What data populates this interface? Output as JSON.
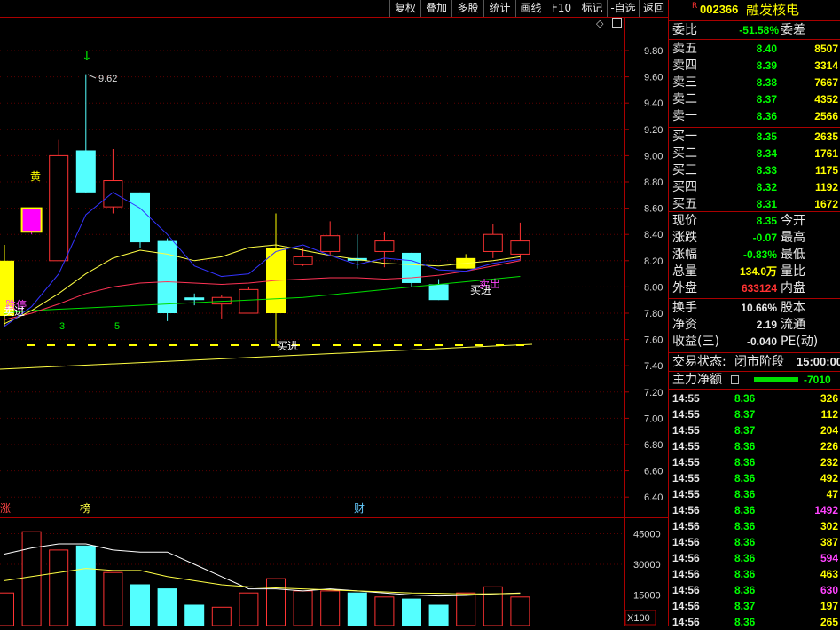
{
  "toolbar": {
    "buttons": [
      "复权",
      "叠加",
      "多股",
      "统计",
      "画线",
      "F10",
      "标记",
      "-自选",
      "返回"
    ]
  },
  "chart": {
    "price_axis": [
      "9.80",
      "9.60",
      "9.40",
      "9.20",
      "9.00",
      "8.80",
      "8.60",
      "8.40",
      "8.20",
      "8.00",
      "7.80",
      "7.60",
      "7.40",
      "7.20",
      "7.00",
      "6.80",
      "6.60",
      "6.40"
    ],
    "volume_axis": [
      "45000",
      "30000",
      "15000"
    ],
    "volume_unit": "X100",
    "high_label": "9.62",
    "annotations": {
      "huang": "黄",
      "limit_up": "涨",
      "bang": "榜",
      "cai": "财",
      "dieting": "跌停",
      "maijin1": "卖进",
      "maijin2": "买进",
      "maijin3": "买进",
      "maichu": "卖出",
      "num3": "3",
      "num5": "5"
    },
    "colors": {
      "up": "#ff3333",
      "down": "#54ffff",
      "flat": "#ffff00",
      "ma5": "#ffffff",
      "ma10": "#ffff00",
      "ma20": "#ff44ff",
      "ma60": "#00ff00"
    }
  },
  "chart_data": {
    "type": "candlestick",
    "candles": [
      {
        "o": 8.2,
        "h": 8.32,
        "l": 7.7,
        "c": 7.78,
        "color": "yellow"
      },
      {
        "o": 8.42,
        "h": 8.6,
        "l": 8.4,
        "c": 8.6,
        "color": "magenta"
      },
      {
        "o": 8.2,
        "h": 9.12,
        "l": 8.2,
        "c": 9.0,
        "color": "red"
      },
      {
        "o": 9.04,
        "h": 9.62,
        "l": 8.72,
        "c": 8.72,
        "color": "cyan"
      },
      {
        "o": 8.61,
        "h": 9.05,
        "l": 8.56,
        "c": 8.81,
        "color": "red"
      },
      {
        "o": 8.72,
        "h": 8.72,
        "l": 8.3,
        "c": 8.34,
        "color": "cyan"
      },
      {
        "o": 8.35,
        "h": 8.37,
        "l": 7.74,
        "c": 7.8,
        "color": "cyan"
      },
      {
        "o": 7.92,
        "h": 7.95,
        "l": 7.86,
        "c": 7.9,
        "color": "cyan"
      },
      {
        "o": 7.87,
        "h": 7.94,
        "l": 7.76,
        "c": 7.92,
        "color": "red"
      },
      {
        "o": 7.8,
        "h": 8.0,
        "l": 7.8,
        "c": 7.98,
        "color": "red"
      },
      {
        "o": 7.8,
        "h": 8.56,
        "l": 7.56,
        "c": 8.3,
        "color": "yellow"
      },
      {
        "o": 8.17,
        "h": 8.3,
        "l": 8.16,
        "c": 8.23,
        "color": "red"
      },
      {
        "o": 8.27,
        "h": 8.5,
        "l": 8.24,
        "c": 8.39,
        "color": "red"
      },
      {
        "o": 8.22,
        "h": 8.4,
        "l": 8.14,
        "c": 8.2,
        "color": "cyan"
      },
      {
        "o": 8.27,
        "h": 8.42,
        "l": 8.15,
        "c": 8.35,
        "color": "red"
      },
      {
        "o": 8.26,
        "h": 8.26,
        "l": 8.0,
        "c": 8.03,
        "color": "cyan"
      },
      {
        "o": 8.02,
        "h": 8.06,
        "l": 7.9,
        "c": 7.9,
        "color": "cyan"
      },
      {
        "o": 8.14,
        "h": 8.25,
        "l": 8.14,
        "c": 8.22,
        "color": "yellow"
      },
      {
        "o": 8.27,
        "h": 8.48,
        "l": 8.22,
        "c": 8.4,
        "color": "red"
      },
      {
        "o": 8.25,
        "h": 8.49,
        "l": 8.2,
        "c": 8.35,
        "color": "red"
      }
    ],
    "volume": [
      16000,
      46000,
      37000,
      39000,
      26000,
      20000,
      18000,
      10000,
      9000,
      16000,
      23000,
      17000,
      17000,
      16000,
      14000,
      13000,
      10000,
      16000,
      19000,
      14000
    ],
    "ylim": [
      6.3,
      10.0
    ],
    "vol_ylim": [
      0,
      50000
    ],
    "x_labels": []
  },
  "quote": {
    "code": "002366",
    "name": "融发核电",
    "r_mark": "R",
    "weibi_label": "委比",
    "weibi": "-51.58%",
    "weicha_label": "委差",
    "sells": [
      {
        "label": "卖五",
        "price": "8.40",
        "vol": "8507"
      },
      {
        "label": "卖四",
        "price": "8.39",
        "vol": "3314"
      },
      {
        "label": "卖三",
        "price": "8.38",
        "vol": "7667"
      },
      {
        "label": "卖二",
        "price": "8.37",
        "vol": "4352"
      },
      {
        "label": "卖一",
        "price": "8.36",
        "vol": "2566"
      }
    ],
    "buys": [
      {
        "label": "买一",
        "price": "8.35",
        "vol": "2635"
      },
      {
        "label": "买二",
        "price": "8.34",
        "vol": "1761"
      },
      {
        "label": "买三",
        "price": "8.33",
        "vol": "1175"
      },
      {
        "label": "买四",
        "price": "8.32",
        "vol": "1192"
      },
      {
        "label": "买五",
        "price": "8.31",
        "vol": "1672"
      }
    ],
    "stats": [
      {
        "l1": "现价",
        "v1": "8.35",
        "c1": "#00ff00",
        "l2": "今开"
      },
      {
        "l1": "涨跌",
        "v1": "-0.07",
        "c1": "#00ff00",
        "l2": "最高"
      },
      {
        "l1": "涨幅",
        "v1": "-0.83%",
        "c1": "#00ff00",
        "l2": "最低"
      },
      {
        "l1": "总量",
        "v1": "134.0万",
        "c1": "#ffff00",
        "l2": "量比"
      },
      {
        "l1": "外盘",
        "v1": "633124",
        "c1": "#ff3333",
        "l2": "内盘"
      }
    ],
    "stats2": [
      {
        "l1": "换手",
        "v1": "10.66%",
        "c1": "#e8e8e8",
        "l2": "股本"
      },
      {
        "l1": "净资",
        "v1": "2.19",
        "c1": "#e8e8e8",
        "l2": "流通"
      },
      {
        "l1": "收益(三)",
        "v1": "-0.040",
        "c1": "#e8e8e8",
        "l2": "PE(动)"
      }
    ],
    "trade_status_label": "交易状态:",
    "trade_status": "闭市阶段",
    "trade_time": "15:00:00",
    "main_net_label": "主力净额",
    "main_net": "-7010",
    "ticks": [
      {
        "t": "14:55",
        "p": "8.36",
        "v": "326",
        "pc": "#00ff00",
        "vc": "#ffff00"
      },
      {
        "t": "14:55",
        "p": "8.37",
        "v": "112",
        "pc": "#00ff00",
        "vc": "#ffff00"
      },
      {
        "t": "14:55",
        "p": "8.37",
        "v": "204",
        "pc": "#00ff00",
        "vc": "#ffff00"
      },
      {
        "t": "14:55",
        "p": "8.36",
        "v": "226",
        "pc": "#00ff00",
        "vc": "#ffff00"
      },
      {
        "t": "14:55",
        "p": "8.36",
        "v": "232",
        "pc": "#00ff00",
        "vc": "#ffff00"
      },
      {
        "t": "14:55",
        "p": "8.36",
        "v": "492",
        "pc": "#00ff00",
        "vc": "#ffff00"
      },
      {
        "t": "14:55",
        "p": "8.36",
        "v": "47",
        "pc": "#00ff00",
        "vc": "#ffff00"
      },
      {
        "t": "14:56",
        "p": "8.36",
        "v": "1492",
        "pc": "#00ff00",
        "vc": "#ff44ff"
      },
      {
        "t": "14:56",
        "p": "8.36",
        "v": "302",
        "pc": "#00ff00",
        "vc": "#ffff00"
      },
      {
        "t": "14:56",
        "p": "8.36",
        "v": "387",
        "pc": "#00ff00",
        "vc": "#ffff00"
      },
      {
        "t": "14:56",
        "p": "8.36",
        "v": "594",
        "pc": "#00ff00",
        "vc": "#ff44ff"
      },
      {
        "t": "14:56",
        "p": "8.36",
        "v": "463",
        "pc": "#00ff00",
        "vc": "#ffff00"
      },
      {
        "t": "14:56",
        "p": "8.36",
        "v": "630",
        "pc": "#00ff00",
        "vc": "#ff44ff"
      },
      {
        "t": "14:56",
        "p": "8.37",
        "v": "197",
        "pc": "#00ff00",
        "vc": "#ffff00"
      },
      {
        "t": "14:56",
        "p": "8.36",
        "v": "265",
        "pc": "#00ff00",
        "vc": "#ffff00"
      }
    ]
  }
}
